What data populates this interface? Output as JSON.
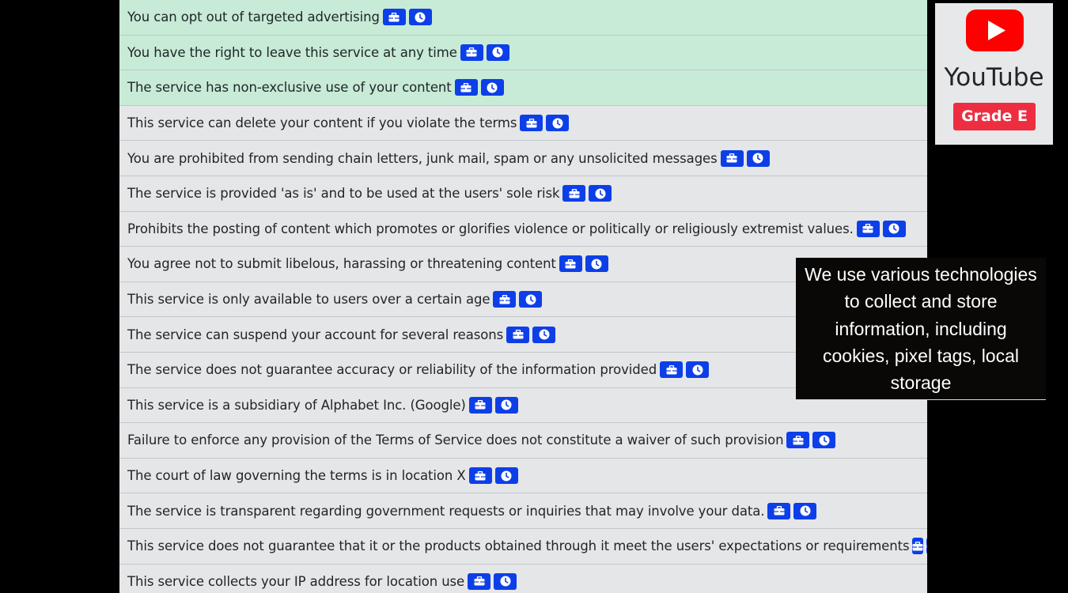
{
  "service": {
    "name": "YouTube",
    "grade": "Grade E",
    "logo_icon": "youtube-logo",
    "logo_color": "#ff0000",
    "grade_color": "#ed2e41"
  },
  "badge_icons": [
    "briefcase-icon",
    "clock-icon"
  ],
  "colors": {
    "good_row": "#c7ebd6",
    "neutral_row": "#e5e6e8",
    "badge": "#0d3fe8"
  },
  "points": [
    {
      "text": "You can opt out of targeted advertising",
      "rating": "good"
    },
    {
      "text": "You have the right to leave this service at any time",
      "rating": "good"
    },
    {
      "text": "The service has non-exclusive use of your content",
      "rating": "good"
    },
    {
      "text": "This service can delete your content if you violate the terms",
      "rating": "neutral"
    },
    {
      "text": "You are prohibited from sending chain letters, junk mail, spam or any unsolicited messages",
      "rating": "neutral"
    },
    {
      "text": "The service is provided 'as is' and to be used at the users' sole risk",
      "rating": "neutral"
    },
    {
      "text": "Prohibits the posting of content which promotes or glorifies violence or politically or religiously extremist values.",
      "rating": "neutral"
    },
    {
      "text": "You agree not to submit libelous, harassing or threatening content",
      "rating": "neutral"
    },
    {
      "text": "This service is only available to users over a certain age",
      "rating": "neutral"
    },
    {
      "text": "The service can suspend your account for several reasons",
      "rating": "neutral"
    },
    {
      "text": "The service does not guarantee accuracy or reliability of the information provided",
      "rating": "neutral"
    },
    {
      "text": "This service is a subsidiary of Alphabet Inc. (Google)",
      "rating": "neutral"
    },
    {
      "text": "Failure to enforce any provision of the Terms of Service does not constitute a waiver of such provision",
      "rating": "neutral"
    },
    {
      "text": "The court of law governing the terms is in location X",
      "rating": "neutral"
    },
    {
      "text": "The service is transparent regarding government requests or inquiries that may involve your data.",
      "rating": "neutral"
    },
    {
      "text": "This service does not guarantee that it or the products obtained through it meet the users' expectations or requirements",
      "rating": "neutral"
    },
    {
      "text": "This service collects your IP address for location use",
      "rating": "neutral"
    }
  ],
  "tooltip": {
    "text": "We use various technologies to collect and store information, including cookies, pixel tags, local storage"
  }
}
